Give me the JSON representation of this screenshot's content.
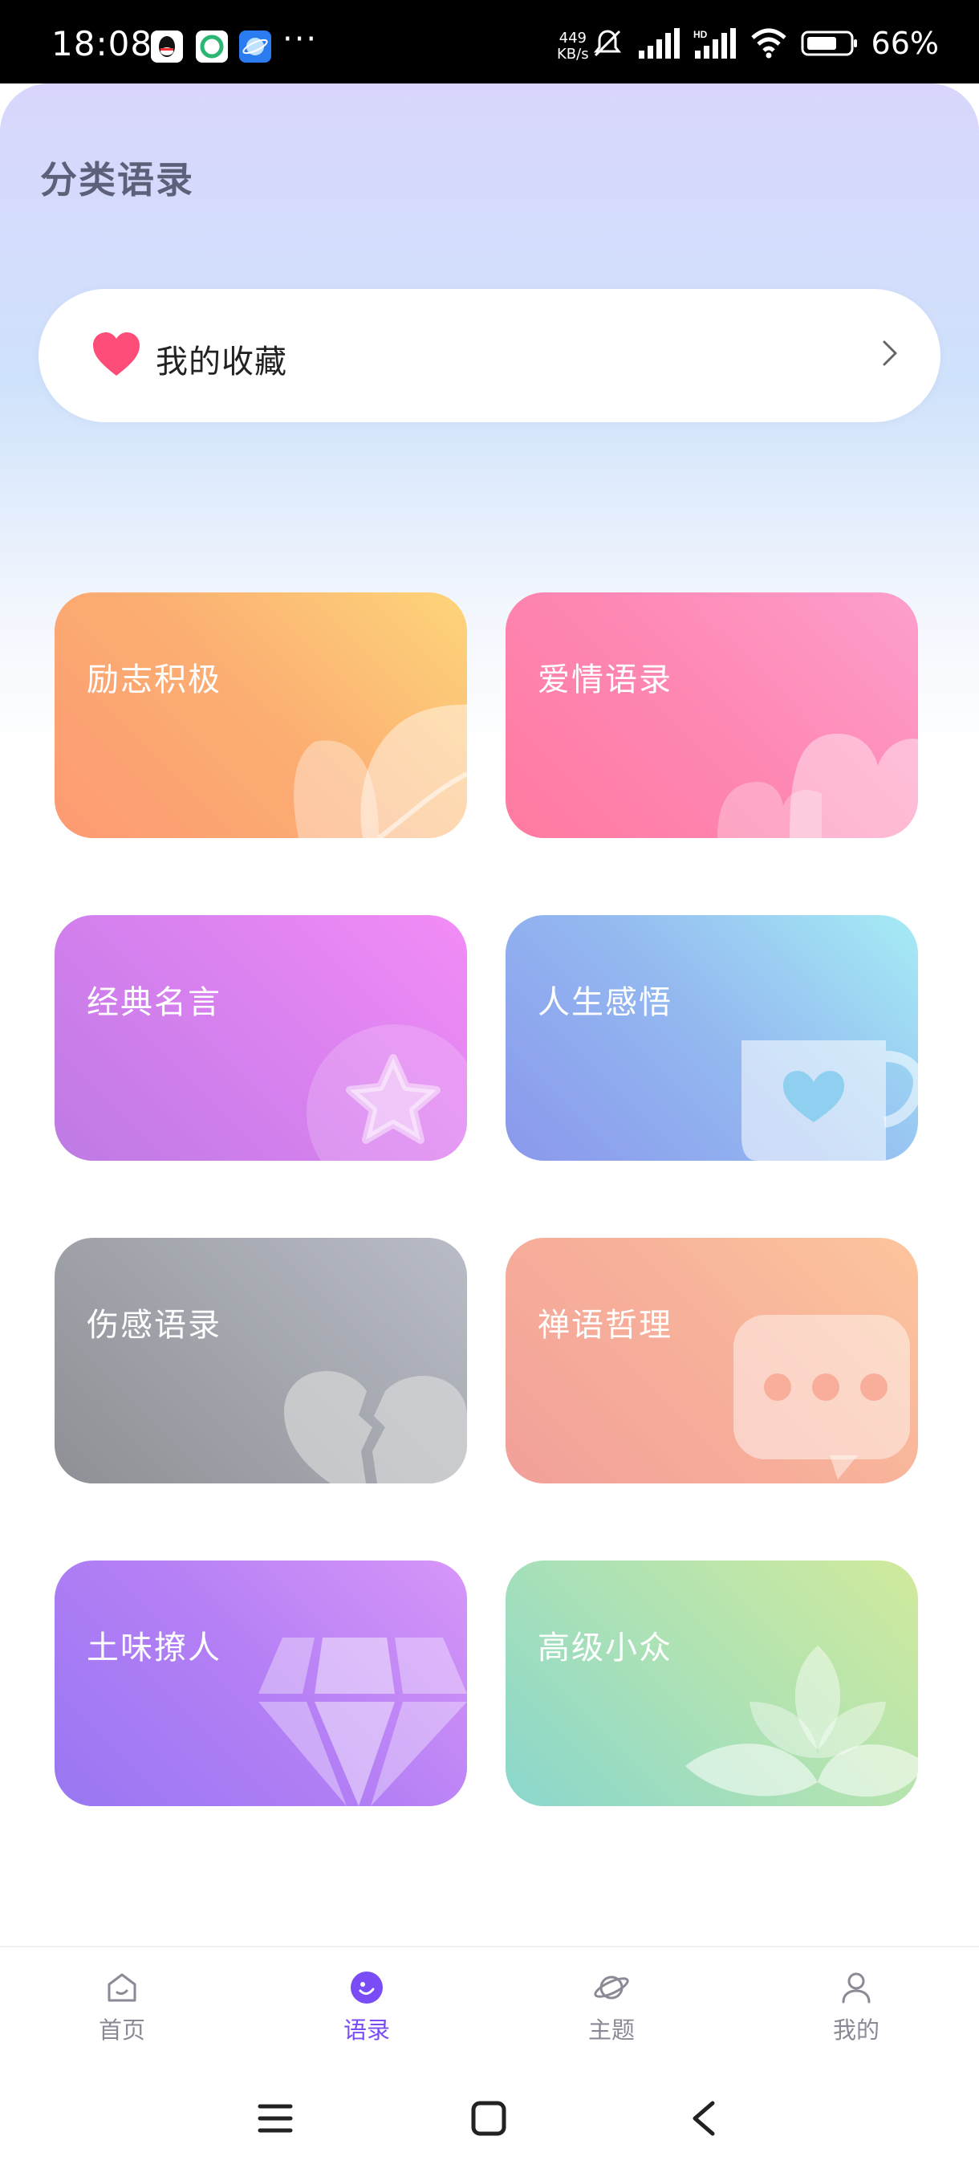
{
  "status_bar": {
    "time": "18:08",
    "net_speed_value": "449",
    "net_speed_unit": "KB/s",
    "battery": "66%",
    "more_dots": "···"
  },
  "page": {
    "title": "分类语录"
  },
  "favorites": {
    "label": "我的收藏",
    "heart_color": "#ff4d7a"
  },
  "categories": [
    {
      "label": "励志积极",
      "icon": "leaf-icon"
    },
    {
      "label": "爱情语录",
      "icon": "heart-icon"
    },
    {
      "label": "经典名言",
      "icon": "star-icon"
    },
    {
      "label": "人生感悟",
      "icon": "cup-icon"
    },
    {
      "label": "伤感语录",
      "icon": "broken-heart-icon"
    },
    {
      "label": "禅语哲理",
      "icon": "chat-bubble-icon"
    },
    {
      "label": "土味撩人",
      "icon": "diamond-icon"
    },
    {
      "label": "高级小众",
      "icon": "lotus-icon"
    }
  ],
  "bottom_nav": [
    {
      "label": "首页",
      "icon": "home-icon",
      "active": false
    },
    {
      "label": "语录",
      "icon": "quote-icon",
      "active": true
    },
    {
      "label": "主题",
      "icon": "planet-icon",
      "active": false
    },
    {
      "label": "我的",
      "icon": "profile-icon",
      "active": false
    }
  ],
  "colors": {
    "accent": "#7a4cf6",
    "title": "#5c6078"
  }
}
